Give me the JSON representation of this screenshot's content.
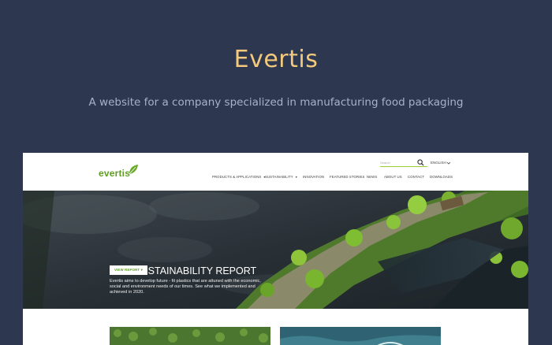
{
  "showcase": {
    "title": "Evertis",
    "subtitle": "A website for a company specialized in manufacturing food packaging"
  },
  "site": {
    "logo_text": "evertis",
    "search": {
      "placeholder": "Search"
    },
    "language": "ENGLISH",
    "nav": [
      {
        "label": "PRODUCTS & APPLICATIONS",
        "has_dropdown": true
      },
      {
        "label": "SUSTAINABILITY",
        "has_dropdown": true
      },
      {
        "label": "INNOVATION",
        "has_dropdown": false
      },
      {
        "label": "FEATURED STORIES",
        "has_dropdown": false
      },
      {
        "label": "NEWS",
        "has_dropdown": false
      },
      {
        "label": "ABOUT US",
        "has_dropdown": false
      },
      {
        "label": "CONTACT",
        "has_dropdown": false
      },
      {
        "label": "DOWNLOADS",
        "has_dropdown": false
      }
    ],
    "hero": {
      "title": "2020 SUSTAINABILITY REPORT",
      "text": "Evertis aims to develop future - fit plastics that are attuned with the economic, social and environment needs of our times. See what we implemented and achieved in 2020.",
      "button": "VIEW REPORT"
    }
  },
  "colors": {
    "background": "#2e3750",
    "title": "#f2c97d",
    "brand_green": "#5e9e23"
  },
  "icons": {
    "search": "search-icon",
    "chevron": "chevron-down-icon",
    "leaf": "leaf-icon"
  }
}
